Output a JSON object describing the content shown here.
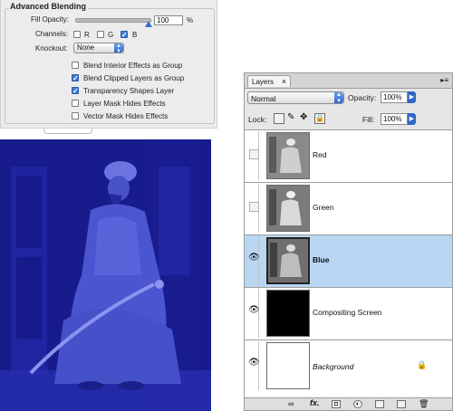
{
  "advanced_blending": {
    "title": "Advanced Blending",
    "fill_opacity_label": "Fill Opacity:",
    "fill_opacity_value": "100",
    "fill_opacity_unit": "%",
    "fill_opacity_level": 1.0,
    "channels_label": "Channels:",
    "channels": [
      {
        "label": "R",
        "checked": false
      },
      {
        "label": "G",
        "checked": false
      },
      {
        "label": "B",
        "checked": true
      }
    ],
    "knockout_label": "Knockout:",
    "knockout_value": "None",
    "options": [
      {
        "label": "Blend Interior Effects as Group",
        "checked": false
      },
      {
        "label": "Blend Clipped Layers as Group",
        "checked": true
      },
      {
        "label": "Transparency Shapes Layer",
        "checked": true
      },
      {
        "label": "Layer Mask Hides Effects",
        "checked": false
      },
      {
        "label": "Vector Mask Hides Effects",
        "checked": false
      }
    ]
  },
  "layers_panel": {
    "tab_label": "Layers",
    "tab_close": "×",
    "blend_mode": "Normal",
    "opacity_label": "Opacity:",
    "opacity_value": "100%",
    "lock_label": "Lock:",
    "fill_label": "Fill:",
    "fill_value": "100%",
    "layers": [
      {
        "name": "Red",
        "visible": false,
        "selected": false,
        "thumb": "photo-gray"
      },
      {
        "name": "Green",
        "visible": false,
        "selected": false,
        "thumb": "photo-gray"
      },
      {
        "name": "Blue",
        "visible": true,
        "selected": true,
        "thumb": "photo-gray"
      },
      {
        "name": "Compositing Screen",
        "visible": true,
        "selected": false,
        "thumb": "black"
      },
      {
        "name": "Background",
        "visible": true,
        "selected": false,
        "thumb": "white",
        "locked": true
      }
    ],
    "bottom_icons": [
      "link-icon",
      "fx-icon",
      "mask-icon",
      "adjustment-icon",
      "folder-icon",
      "new-layer-icon",
      "trash-icon"
    ],
    "fx_label": "fx."
  },
  "colors": {
    "photo_tint": "#1a1f9c",
    "selected_row": "#b9d6f2",
    "accent": "#3d7ad6"
  }
}
